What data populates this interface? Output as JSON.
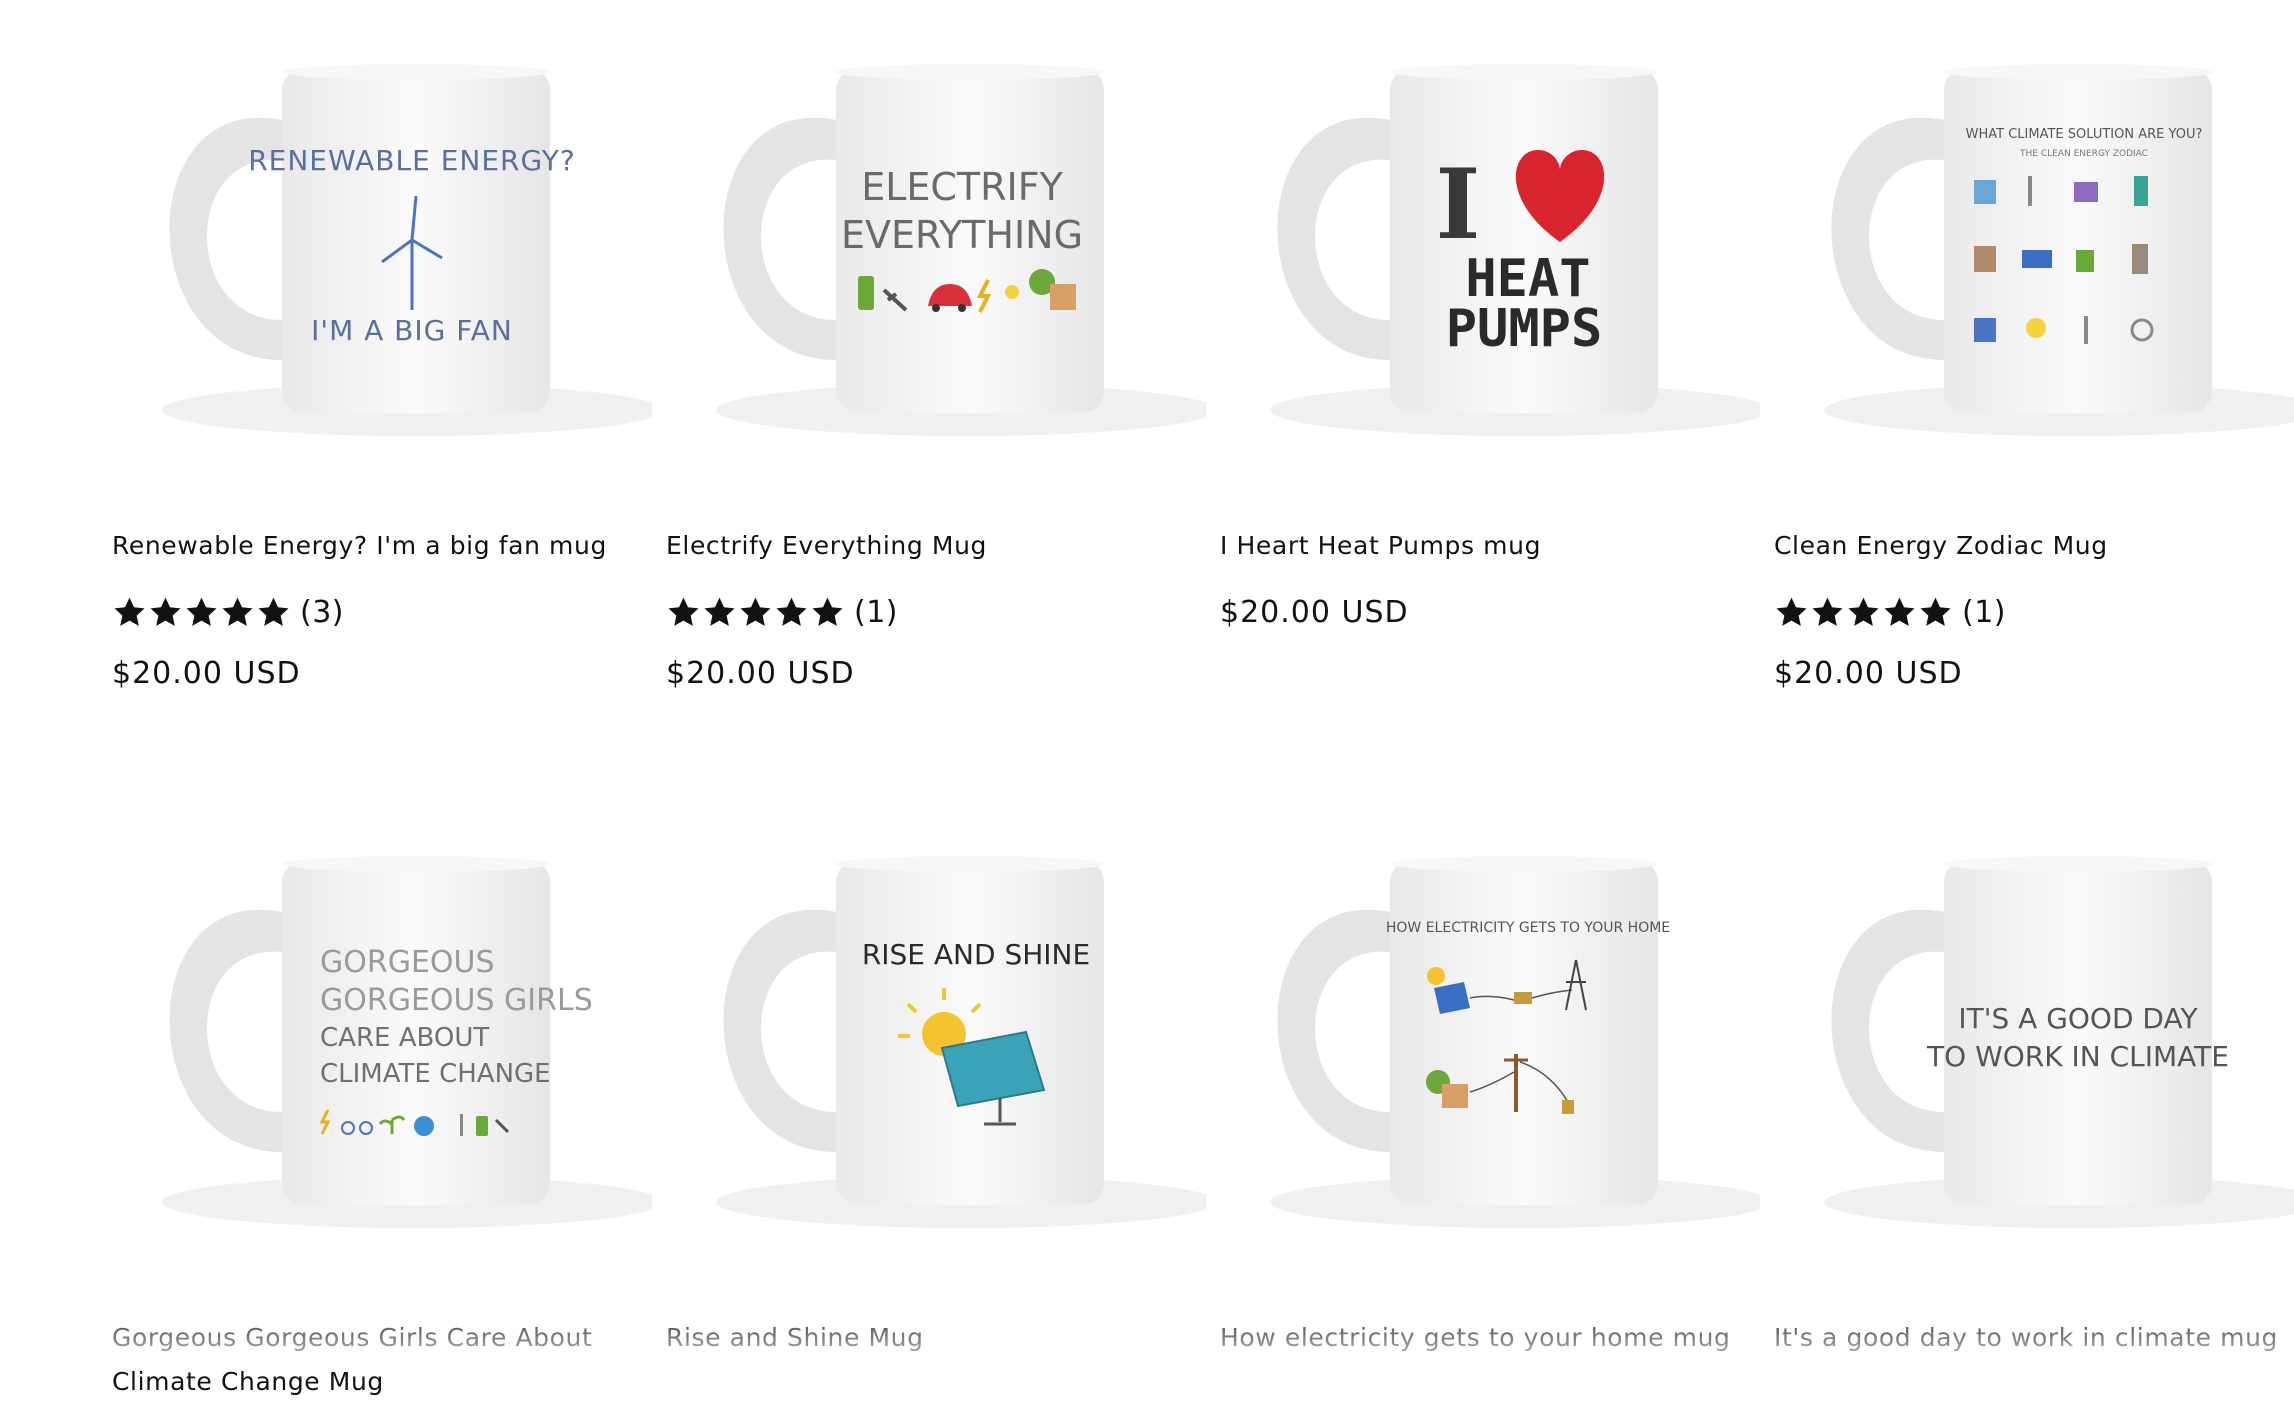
{
  "products": [
    {
      "title": "Renewable Energy? I'm a big fan mug",
      "rating": 5,
      "review_count": "(3)",
      "price": "$20.00 USD",
      "mug_text": [
        "RENEWABLE ENERGY?",
        "I'M A BIG FAN"
      ],
      "mug_icon": "wind-turbine-icon"
    },
    {
      "title": "Electrify Everything Mug",
      "rating": 5,
      "review_count": "(1)",
      "price": "$20.00 USD",
      "mug_text": [
        "ELECTRIFY",
        "EVERYTHING"
      ],
      "mug_icon": "electric-icons-row"
    },
    {
      "title": "I Heart Heat Pumps mug",
      "price": "$20.00 USD",
      "mug_text": [
        "I",
        "HEAT",
        "PUMPS"
      ],
      "mug_icon": "heart-icon"
    },
    {
      "title": "Clean Energy Zodiac Mug",
      "rating": 5,
      "review_count": "(1)",
      "price": "$20.00 USD",
      "mug_text": [
        "WHAT CLIMATE SOLUTION ARE YOU?",
        "THE CLEAN ENERGY ZODIAC"
      ],
      "mug_icon": "zodiac-grid-icon"
    },
    {
      "title": "Gorgeous Gorgeous Girls Care About Climate Change Mug",
      "mug_text": [
        "GORGEOUS",
        "GORGEOUS GIRLS",
        "CARE ABOUT",
        "CLIMATE CHANGE"
      ],
      "mug_icon": "climate-icons-row"
    },
    {
      "title": "Rise and Shine Mug",
      "mug_text": [
        "RISE AND SHINE"
      ],
      "mug_icon": "sun-solar-panel-icon"
    },
    {
      "title": "How electricity gets to your home mug",
      "mug_text": [
        "HOW ELECTRICITY GETS TO YOUR HOME"
      ],
      "mug_icon": "electricity-diagram-icon"
    },
    {
      "title": "It's a good day to work in climate mug",
      "mug_text": [
        "IT'S A GOOD DAY",
        "TO WORK IN CLIMATE"
      ],
      "mug_icon": ""
    }
  ],
  "colors": {
    "text": "#121212",
    "star": "#121212",
    "mug_body": "#f4f4f4",
    "heart": "#d8242f"
  }
}
